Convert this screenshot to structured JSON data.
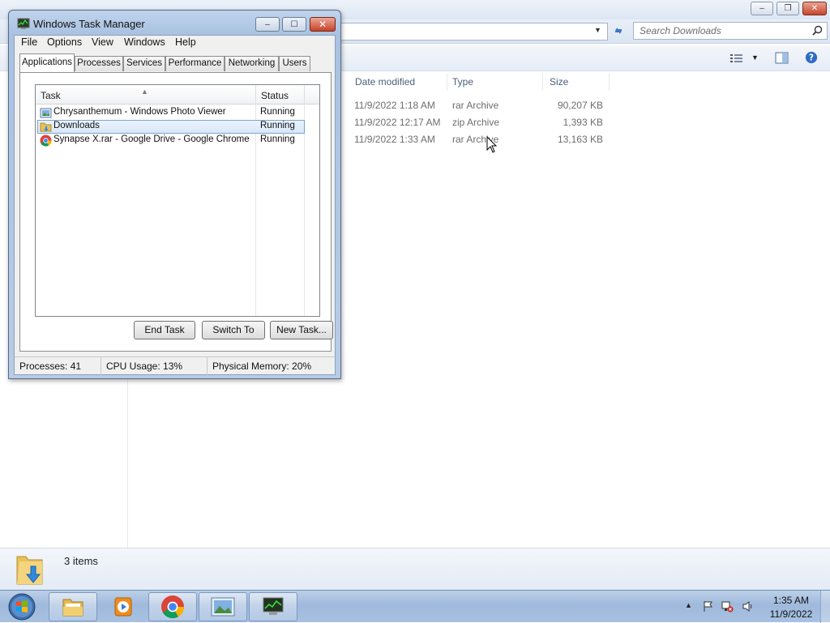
{
  "explorer": {
    "search_placeholder": "Search Downloads",
    "columns": [
      "Date modified",
      "Type",
      "Size"
    ],
    "files": [
      {
        "date": "11/9/2022 1:18 AM",
        "type": "rar Archive",
        "size": "90,207 KB"
      },
      {
        "date": "11/9/2022 12:17 AM",
        "type": "zip Archive",
        "size": "1,393 KB"
      },
      {
        "date": "11/9/2022 1:33 AM",
        "type": "rar Archive",
        "size": "13,163 KB"
      }
    ],
    "status_count": "3 items"
  },
  "taskmgr": {
    "title": "Windows Task Manager",
    "menu": [
      "File",
      "Options",
      "View",
      "Windows",
      "Help"
    ],
    "tabs": [
      "Applications",
      "Processes",
      "Services",
      "Performance",
      "Networking",
      "Users"
    ],
    "active_tab": "Applications",
    "columns": {
      "task": "Task",
      "status": "Status"
    },
    "tasks": [
      {
        "name": "Chrysanthemum - Windows Photo Viewer",
        "status": "Running",
        "icon": "photo-viewer-icon"
      },
      {
        "name": "Downloads",
        "status": "Running",
        "icon": "folder-icon",
        "selected": true
      },
      {
        "name": "Synapse X.rar - Google Drive - Google Chrome",
        "status": "Running",
        "icon": "chrome-icon"
      }
    ],
    "buttons": {
      "end_task": "End Task",
      "switch_to": "Switch To",
      "new_task": "New Task..."
    },
    "status": {
      "processes": "Processes: 41",
      "cpu": "CPU Usage: 13%",
      "memory": "Physical Memory: 20%"
    }
  },
  "taskbar": {
    "apps": [
      "explorer-icon",
      "media-player-icon",
      "chrome-icon",
      "photo-viewer-icon",
      "task-manager-icon"
    ],
    "clock_time": "1:35 AM",
    "clock_date": "11/9/2022"
  },
  "colors": {
    "accent": "#3a6ea5",
    "selection": "#d8e8fa",
    "taskbar": "#a8c1e1"
  }
}
